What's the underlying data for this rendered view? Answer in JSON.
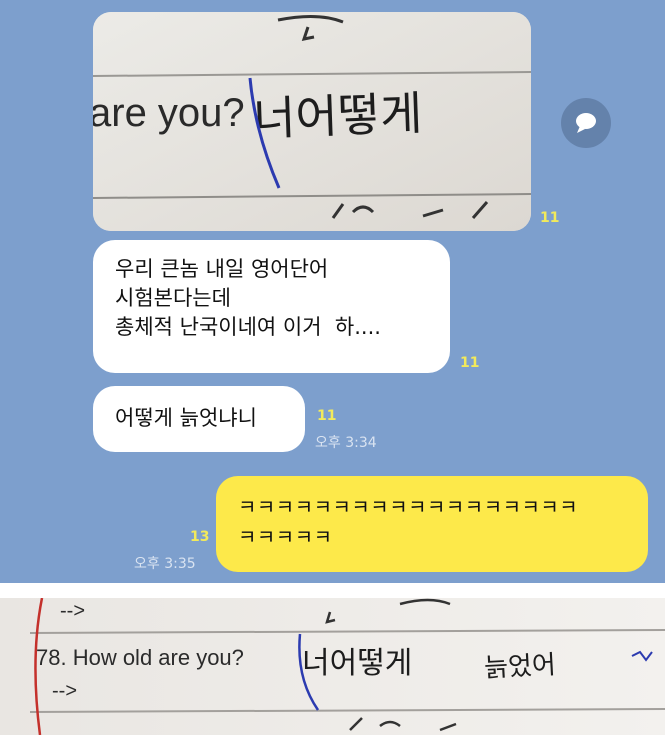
{
  "chat": {
    "background_color": "#7d9fcd",
    "photo_top": {
      "printed_text": "are you?",
      "handwritten_text": "너어떻게"
    },
    "share_button_icon": "speech-bubble-icon",
    "messages": [
      {
        "lines": [
          "우리 큰놈 내일 영어단어",
          "시험본다는데",
          "총체적 난국이네여 이거  하...."
        ],
        "unread_count": "11"
      },
      {
        "lines": [
          "어떻게 늙엇냐니"
        ],
        "unread_count": "11",
        "time": "오후 3:34"
      },
      {
        "lines": [
          "ㅋㅋㅋㅋㅋㅋㅋㅋㅋㅋㅋㅋㅋㅋㅋㅋㅋㅋ",
          "ㅋㅋㅋㅋㅋ"
        ],
        "unread_count": "13",
        "time": "오후 3:35",
        "sender": "me"
      }
    ]
  },
  "photo_bottom": {
    "arrow_top": "-->",
    "question": "78. How old are you?",
    "handwritten_answer": "너어떻게",
    "handwritten_answer_2": "늙었어",
    "arrow_bottom": "-->"
  }
}
